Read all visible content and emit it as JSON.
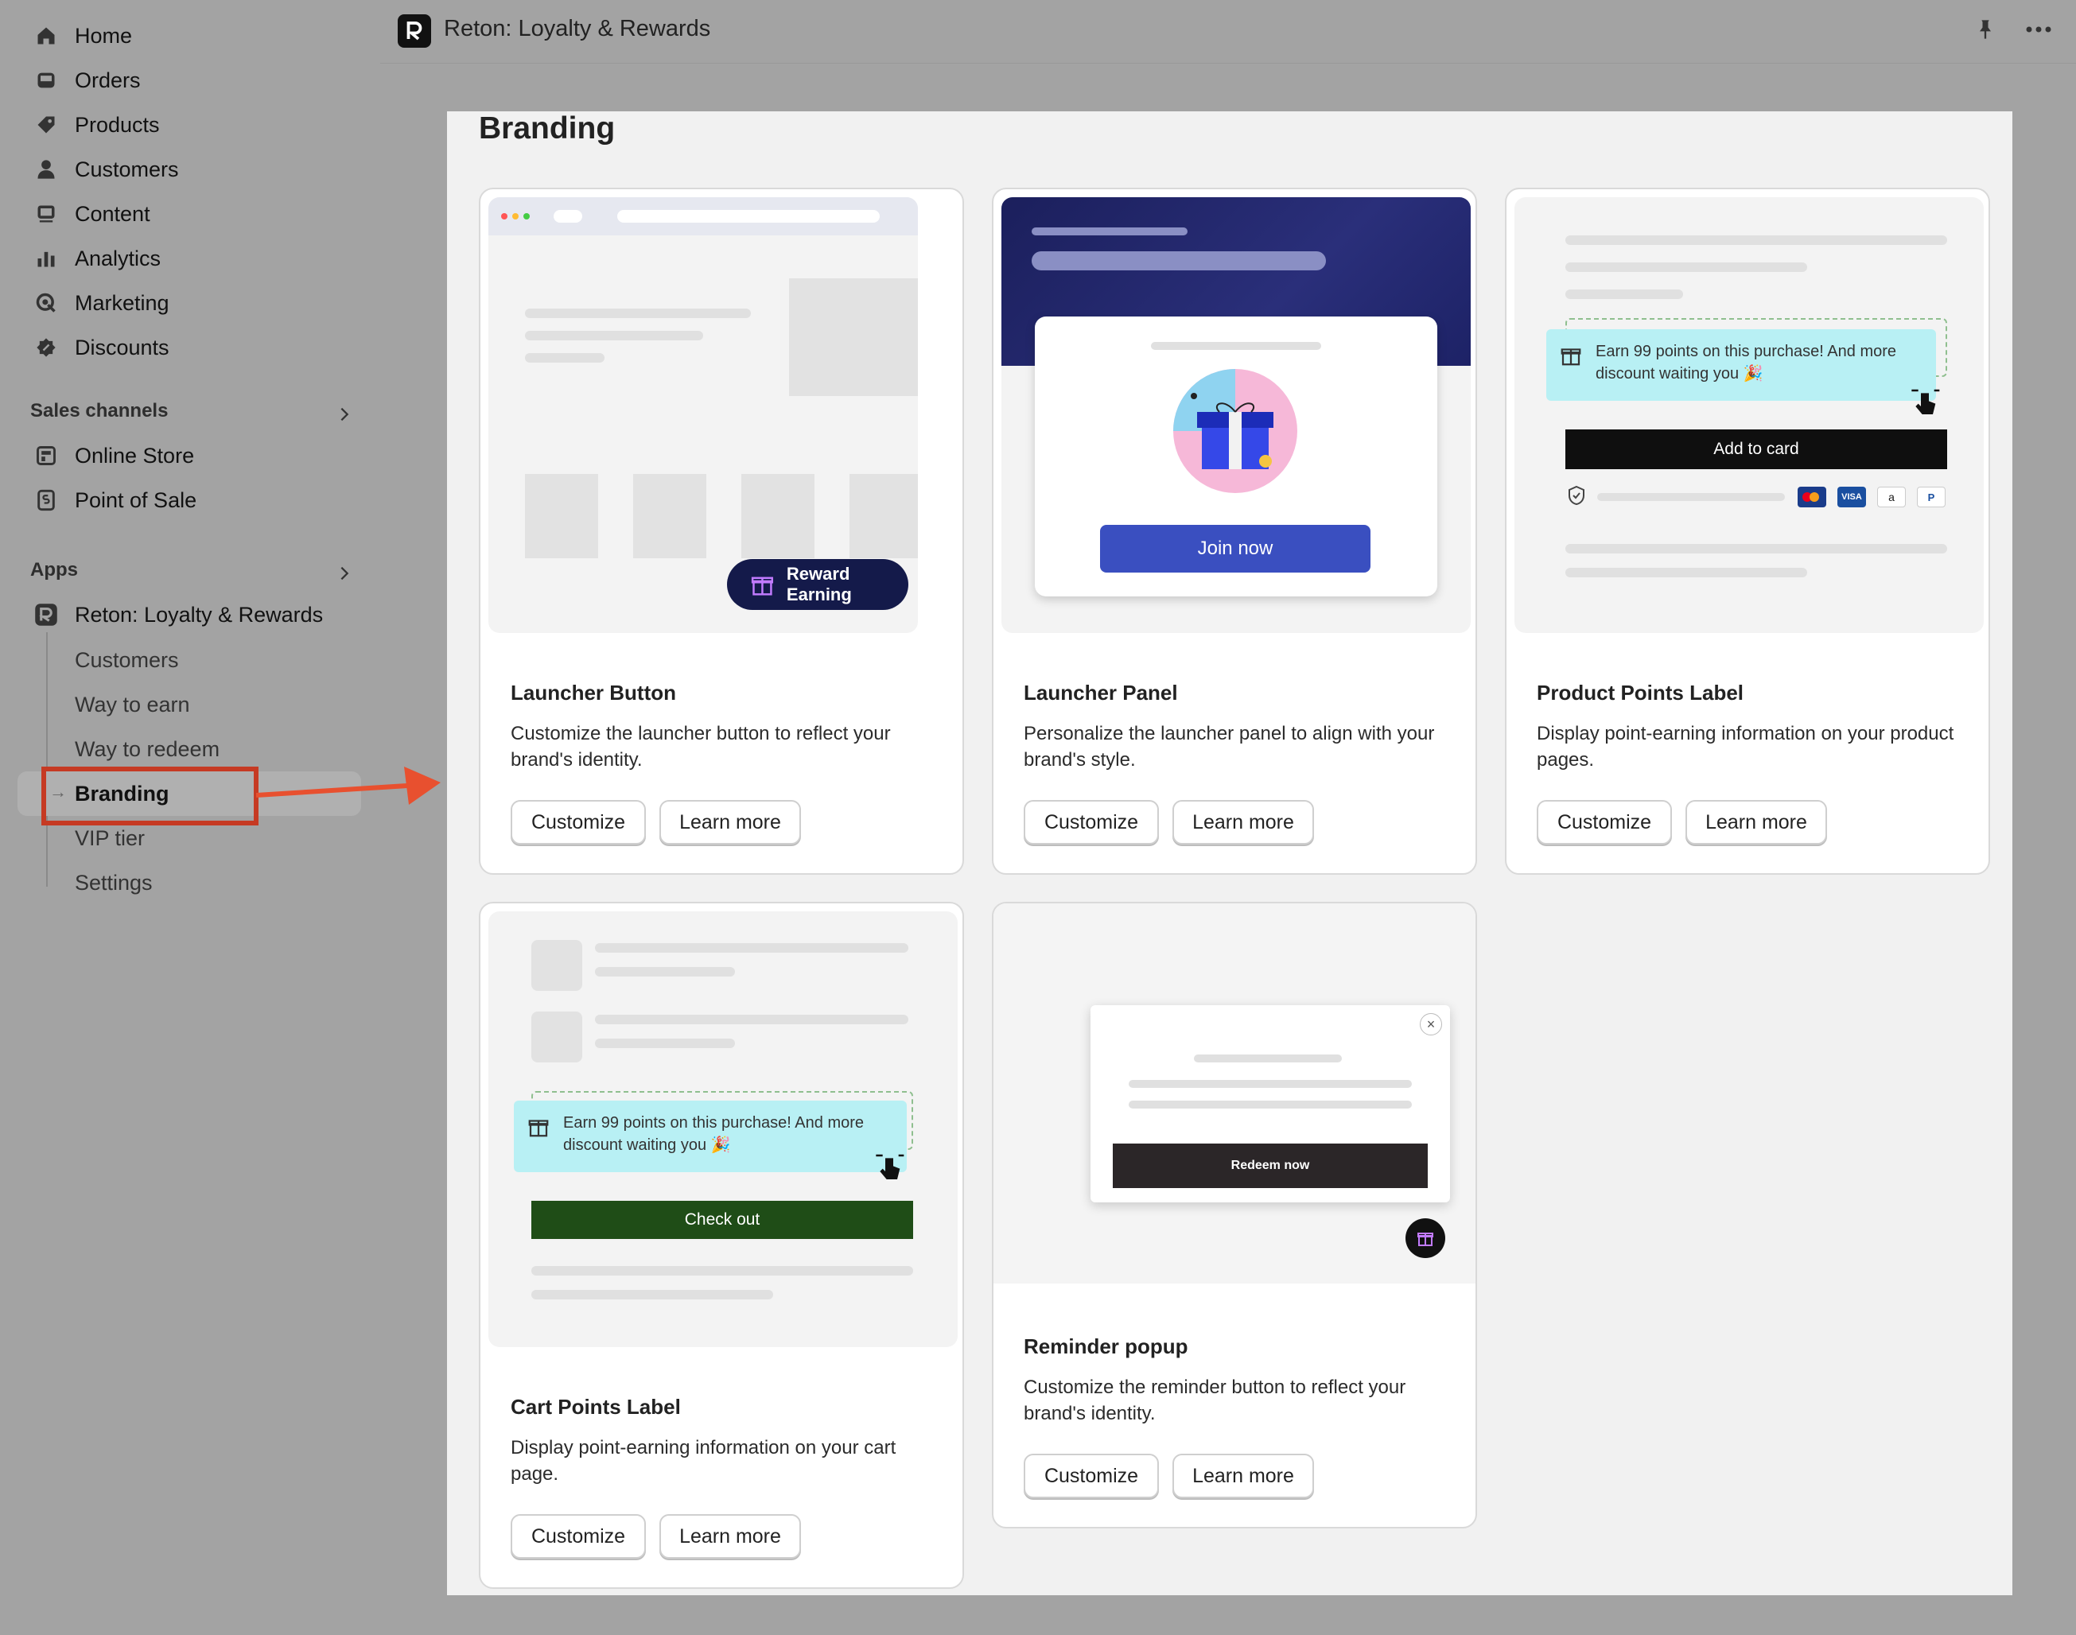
{
  "sidebar": {
    "nav": [
      {
        "label": "Home",
        "icon": "home-icon"
      },
      {
        "label": "Orders",
        "icon": "inbox-icon"
      },
      {
        "label": "Products",
        "icon": "tag-icon"
      },
      {
        "label": "Customers",
        "icon": "person-icon"
      },
      {
        "label": "Content",
        "icon": "image-icon"
      },
      {
        "label": "Analytics",
        "icon": "bar-chart-icon"
      },
      {
        "label": "Marketing",
        "icon": "target-icon"
      },
      {
        "label": "Discounts",
        "icon": "discount-badge-icon"
      }
    ],
    "sales_channels_label": "Sales channels",
    "channels": [
      {
        "label": "Online Store",
        "icon": "store-icon"
      },
      {
        "label": "Point of Sale",
        "icon": "pos-icon"
      }
    ],
    "apps_label": "Apps",
    "app": {
      "label": "Reton: Loyalty & Rewards",
      "icon": "reton-logo-icon"
    },
    "app_subitems": [
      "Customers",
      "Way to earn",
      "Way to redeem",
      "Branding",
      "VIP tier",
      "Settings"
    ],
    "active_subitem": "Branding"
  },
  "header": {
    "title": "Reton: Loyalty & Rewards"
  },
  "main": {
    "page_title": "Branding",
    "cards": [
      {
        "title": "Launcher Button",
        "desc": "Customize the launcher button to reflect your brand's identity.",
        "customize": "Customize",
        "learn_more": "Learn more",
        "preview_label": "Reward Earning"
      },
      {
        "title": "Launcher Panel",
        "desc": "Personalize the launcher panel to align with your brand's style.",
        "customize": "Customize",
        "learn_more": "Learn more",
        "preview_label": "Join now"
      },
      {
        "title": "Product Points Label",
        "desc": "Display point-earning information on your product pages.",
        "customize": "Customize",
        "learn_more": "Learn more",
        "preview_msg": "Earn 99 points on this purchase! And more discount waiting you 🎉",
        "preview_button": "Add to card"
      },
      {
        "title": "Cart Points Label",
        "desc": "Display point-earning information on your cart page.",
        "customize": "Customize",
        "learn_more": "Learn more",
        "preview_msg": "Earn 99 points on this purchase! And more discount waiting you 🎉",
        "preview_button": "Check out"
      },
      {
        "title": "Reminder popup",
        "desc": "Customize the reminder button to reflect your brand's identity.",
        "customize": "Customize",
        "learn_more": "Learn more",
        "preview_button": "Redeem now"
      }
    ]
  },
  "colors": {
    "highlight": "#c63a23",
    "launcher_navy": "#141a4a",
    "join_blue": "#3a4fc0",
    "checkout_green": "#1f4d17",
    "teal": "#b8f0f4"
  }
}
